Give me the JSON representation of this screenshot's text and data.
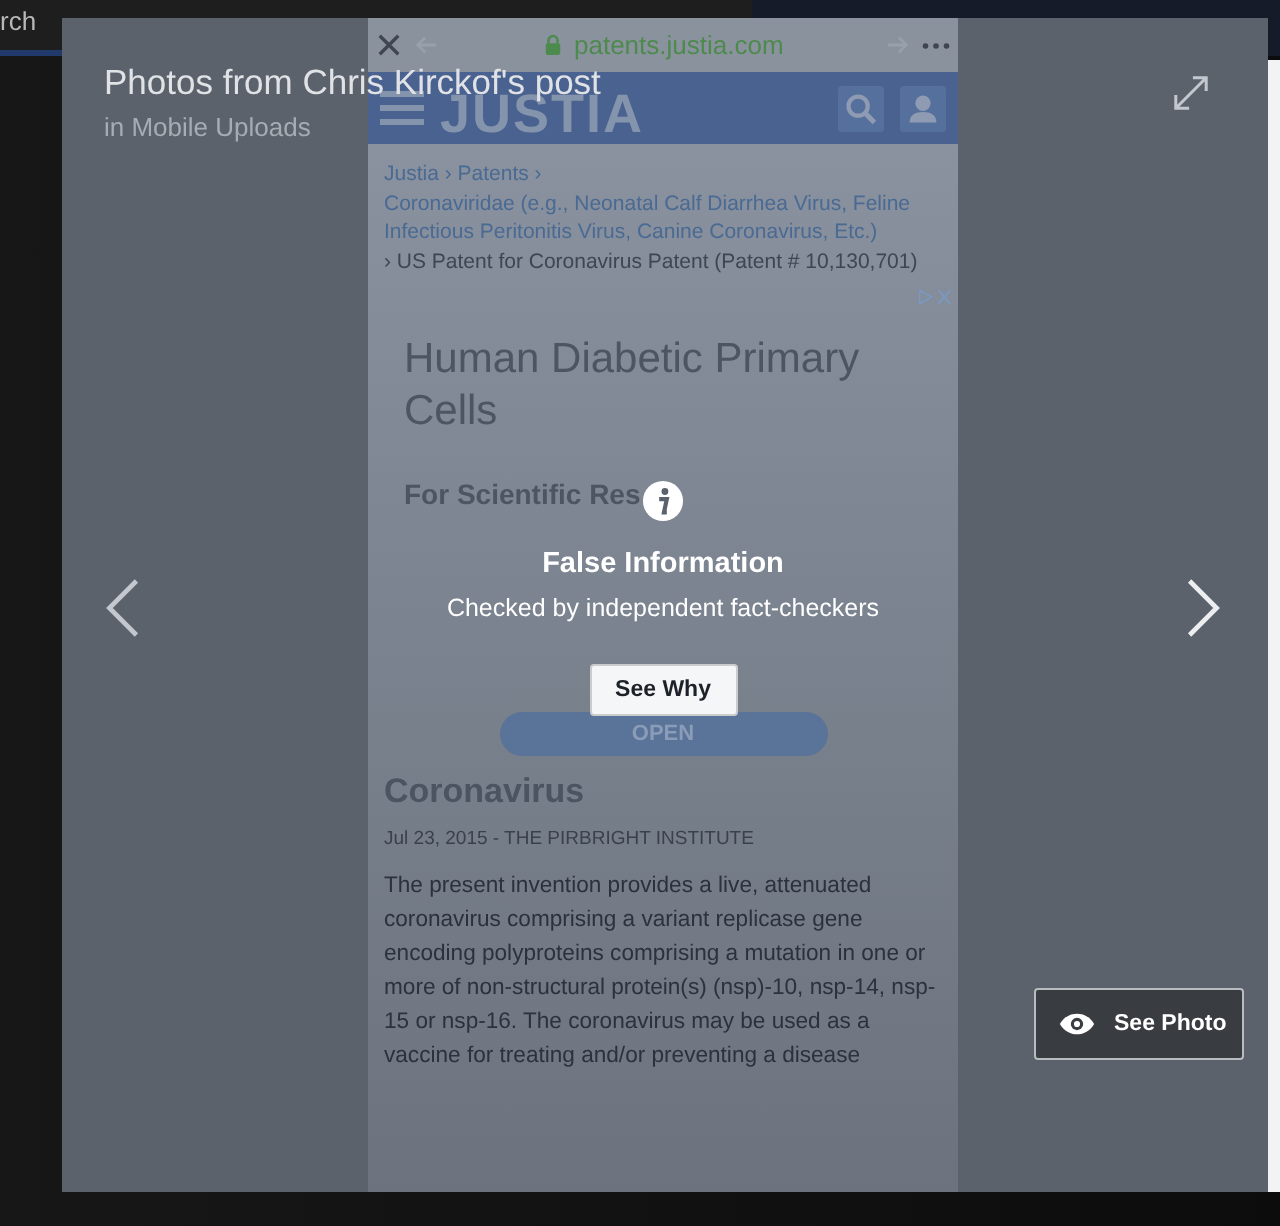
{
  "topbar": {
    "search_text": "rch"
  },
  "viewer": {
    "title": "Photos from Chris Kirckof's post",
    "subtitle": "in Mobile Uploads"
  },
  "photo": {
    "kind": "screenshot",
    "url": "patents.justia.com",
    "site_name": "JUSTIA",
    "breadcrumb": "Justia › Patents ›",
    "category": "Coronaviridae (e.g., Neonatal Calf Diarrhea Virus, Feline Infectious Peritonitis Virus, Canine Coronavirus, Etc.)",
    "page_title": "› US Patent for Coronavirus Patent (Patent # 10,130,701)",
    "ad": {
      "title": "Human Diabetic Primary Cells",
      "subtitle": "For Scientific Res",
      "button": "OPEN"
    },
    "result": {
      "title": "Coronavirus",
      "meta": "Jul 23, 2015 - THE PIRBRIGHT INSTITUTE",
      "abstract": "The present invention provides a live, attenuated coronavirus comprising a variant replicase gene encoding polyproteins comprising a mutation in one or more of non-structural protein(s) (nsp)-10, nsp-14, nsp-15 or nsp-16. The coronavirus may be used as a vaccine for treating and/or preventing a disease"
    }
  },
  "warning": {
    "title": "False Information",
    "message": "Checked by independent fact-checkers",
    "button": "See Why"
  },
  "see_photo_button": "See Photo"
}
